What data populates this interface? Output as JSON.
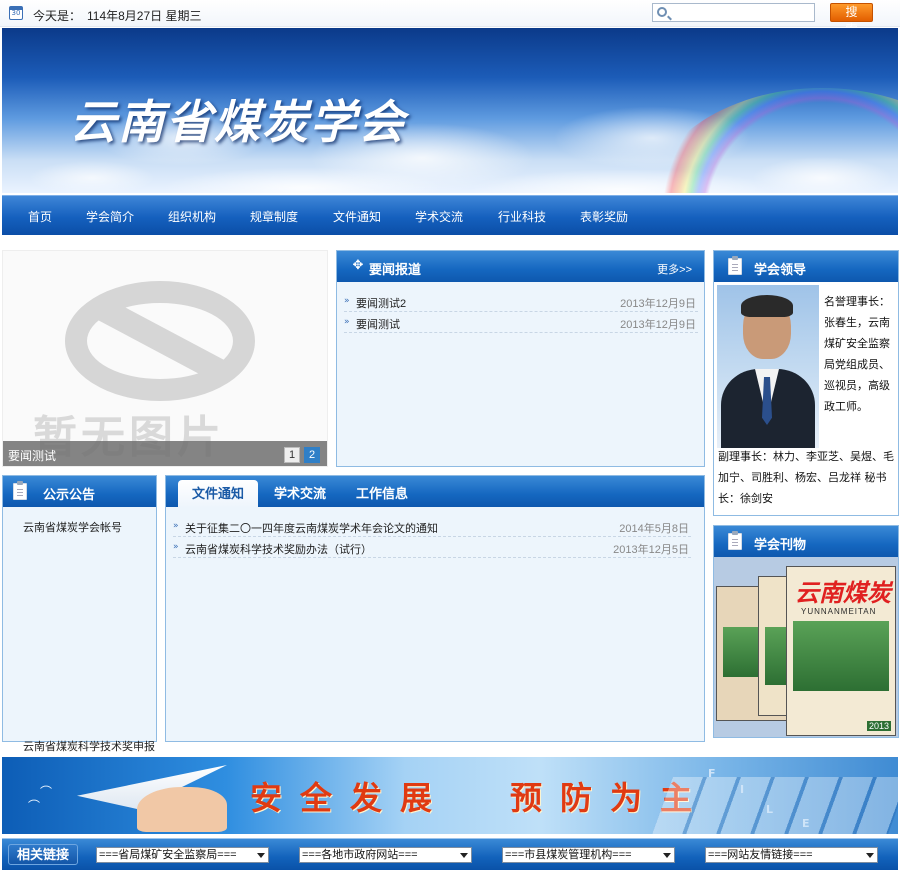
{
  "topbar": {
    "calendar_badge": "30",
    "today_label": "今天是：",
    "today_date": "114年8月27日 星期三",
    "search_placeholder": "",
    "search_button": "搜 索"
  },
  "banner": {
    "title": "云南省煤炭学会"
  },
  "nav": {
    "items": [
      "首页",
      "学会简介",
      "组织机构",
      "规章制度",
      "文件通知",
      "学术交流",
      "行业科技",
      "表彰奖励"
    ]
  },
  "slideshow": {
    "placeholder_text": "暂无图片",
    "caption": "要闻测试",
    "pages": [
      "1",
      "2"
    ]
  },
  "news": {
    "title": "要闻报道",
    "more": "更多>>",
    "items": [
      {
        "title": "要闻测试2",
        "date": "2013年12月9日"
      },
      {
        "title": "要闻测试",
        "date": "2013年12月9日"
      }
    ]
  },
  "leadership": {
    "title": "学会领导",
    "bio_side": "名誉理事长：张春生，云南煤矿安全监察局党组成员、巡视员，高级政工师。",
    "bio_full": "副理事长：林力、李亚芝、吴煜、毛加宁、司胜利、杨宏、吕龙祥  秘书长：徐剑安"
  },
  "notices": {
    "title": "公示公告",
    "items": [
      "云南省煤炭学会帐号",
      "云南省煤炭科学技术奖申报"
    ]
  },
  "documents": {
    "tabs": [
      "文件通知",
      "学术交流",
      "工作信息"
    ],
    "items": [
      {
        "title": "关于征集二〇一四年度云南煤炭学术年会论文的通知",
        "date": "2014年5月8日"
      },
      {
        "title": "云南省煤炭科学技术奖励办法（试行）",
        "date": "2013年12月5日"
      }
    ]
  },
  "journal": {
    "title": "学会刊物",
    "cover_title": "云南煤炭",
    "cover_pinyin": "YUNNANMEITAN",
    "cover_year": "2013"
  },
  "safety_banner": {
    "slogan_left": "安全发展",
    "slogan_right": "预防为主",
    "keys": [
      "F",
      "I",
      "L",
      "E"
    ]
  },
  "links": {
    "title": "相关链接",
    "selects": [
      "===省局煤矿安全监察局===",
      "===各地市政府网站===",
      "===市县煤炭管理机构===",
      "===网站友情链接==="
    ]
  }
}
